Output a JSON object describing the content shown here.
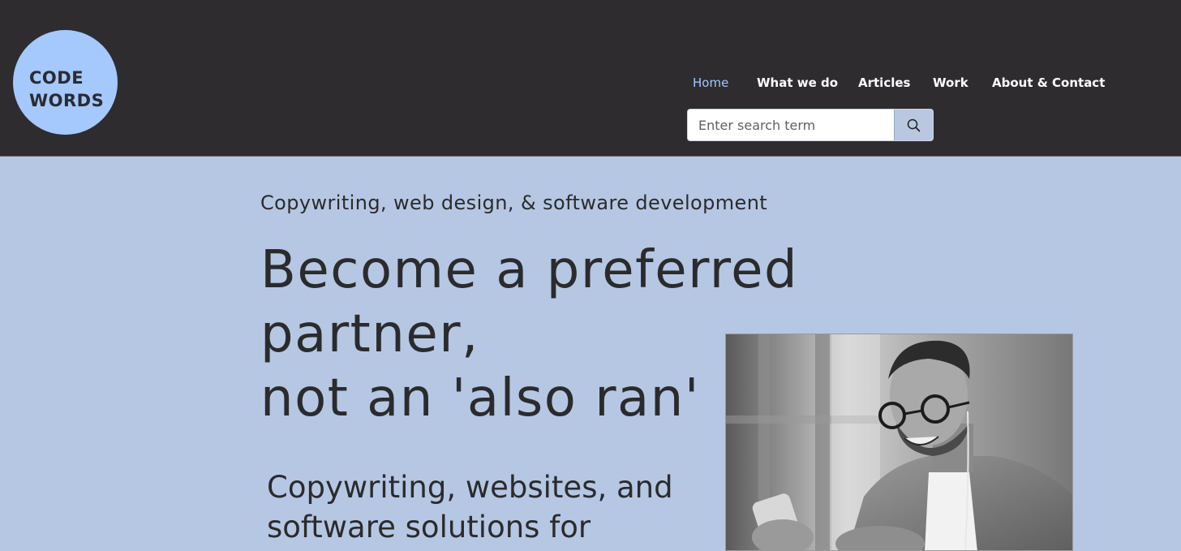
{
  "logo": {
    "line1": "CODE",
    "line2": "WORDS"
  },
  "nav": {
    "items": [
      {
        "label": "Home",
        "active": true
      },
      {
        "label": "What we do",
        "active": false
      },
      {
        "label": "Articles",
        "active": false
      },
      {
        "label": "Work",
        "active": false
      },
      {
        "label": "About & Contact",
        "active": false
      }
    ]
  },
  "search": {
    "placeholder": "Enter search term",
    "value": ""
  },
  "hero": {
    "tagline": "Copywriting, web design, & software development",
    "headline_line1": "Become a preferred partner,",
    "headline_line2": "not an 'also ran'",
    "subhead_line1": "Copywriting, websites, and",
    "subhead_line2": "software solutions for"
  },
  "colors": {
    "header_bg": "#2e2c2f",
    "page_bg": "#b5c7e3",
    "logo_bg": "#a5c8fd",
    "nav_active": "#a5c8fd",
    "text_dark": "#2b2b2d"
  },
  "icons": {
    "search": "magnifier-icon"
  }
}
